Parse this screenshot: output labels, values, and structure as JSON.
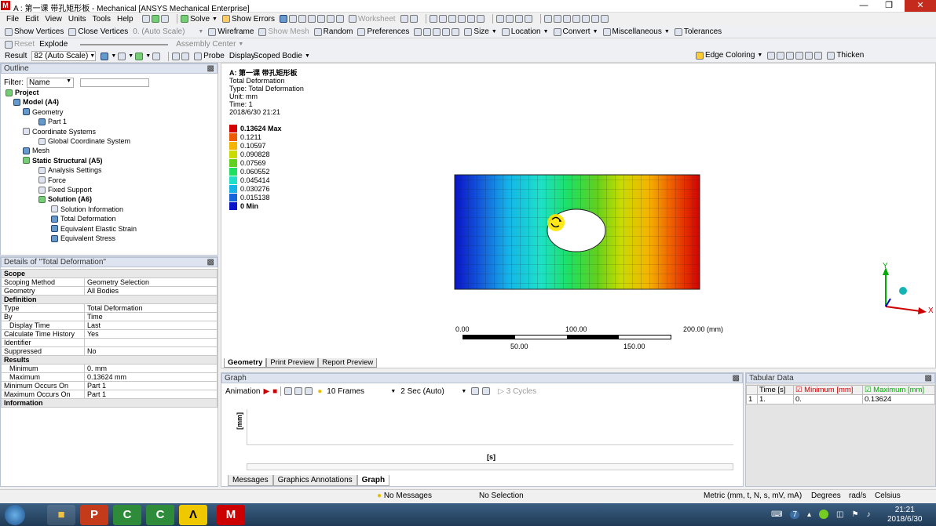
{
  "window": {
    "title": "A : 第一课 带孔矩形板 - Mechanical [ANSYS Mechanical Enterprise]",
    "app_icon_letter": "M"
  },
  "menu": [
    "File",
    "Edit",
    "View",
    "Units",
    "Tools",
    "Help"
  ],
  "toolbar1": {
    "solve": "Solve",
    "show_errors": "Show Errors",
    "worksheet": "Worksheet"
  },
  "toolbar2": {
    "show_vertices": "Show Vertices",
    "close_vertices": "Close Vertices",
    "auto_scale": "0. (Auto Scale)",
    "wireframe": "Wireframe",
    "show_mesh": "Show Mesh",
    "random": "Random",
    "preferences": "Preferences",
    "size": "Size",
    "location": "Location",
    "convert": "Convert",
    "miscellaneous": "Miscellaneous",
    "tolerances": "Tolerances"
  },
  "toolbar3": {
    "reset": "Reset",
    "explode": "Explode",
    "assembly_center": "Assembly Center"
  },
  "toolbar4": {
    "result_label": "Result",
    "scale_value": "82 (Auto Scale)",
    "probe": "Probe",
    "display_label": "Display",
    "display_value": "Scoped Bodie",
    "edge_coloring": "Edge Coloring",
    "thicken": "Thicken"
  },
  "outline": {
    "header": "Outline",
    "filter_label": "Filter:",
    "filter_value": "Name",
    "items": [
      {
        "label": "Project",
        "bold": true
      },
      {
        "label": "Model (A4)",
        "bold": true
      },
      {
        "label": "Geometry"
      },
      {
        "label": "Part 1"
      },
      {
        "label": "Coordinate Systems"
      },
      {
        "label": "Global Coordinate System"
      },
      {
        "label": "Mesh"
      },
      {
        "label": "Static Structural (A5)",
        "bold": true
      },
      {
        "label": "Analysis Settings"
      },
      {
        "label": "Force"
      },
      {
        "label": "Fixed Support"
      },
      {
        "label": "Solution (A6)",
        "bold": true
      },
      {
        "label": "Solution Information"
      },
      {
        "label": "Total Deformation"
      },
      {
        "label": "Equivalent Elastic Strain"
      },
      {
        "label": "Equivalent Stress"
      }
    ]
  },
  "details": {
    "header": "Details of \"Total Deformation\"",
    "rows": [
      {
        "section": "Scope"
      },
      {
        "k": "Scoping Method",
        "v": "Geometry Selection"
      },
      {
        "k": "Geometry",
        "v": "All Bodies"
      },
      {
        "section": "Definition"
      },
      {
        "k": "Type",
        "v": "Total Deformation"
      },
      {
        "k": "By",
        "v": "Time"
      },
      {
        "k": "Display Time",
        "v": "Last"
      },
      {
        "k": "Calculate Time History",
        "v": "Yes"
      },
      {
        "k": "Identifier",
        "v": ""
      },
      {
        "k": "Suppressed",
        "v": "No"
      },
      {
        "section": "Results"
      },
      {
        "k": "Minimum",
        "v": "0. mm"
      },
      {
        "k": "Maximum",
        "v": "0.13624 mm"
      },
      {
        "k": "Minimum Occurs On",
        "v": "Part 1"
      },
      {
        "k": "Maximum Occurs On",
        "v": "Part 1"
      },
      {
        "section": "Information"
      }
    ]
  },
  "viewport": {
    "heading": "A: 第一课 带孔矩形板",
    "info": [
      "Total Deformation",
      "Type: Total Deformation",
      "Unit: mm",
      "Time: 1",
      "2018/6/30 21:21"
    ],
    "legend": [
      {
        "label": "0.13624 Max",
        "color": "#d40000"
      },
      {
        "label": "0.1211",
        "color": "#ee5a00"
      },
      {
        "label": "0.10597",
        "color": "#f5b400"
      },
      {
        "label": "0.090828",
        "color": "#c8dc00"
      },
      {
        "label": "0.07569",
        "color": "#62d01e"
      },
      {
        "label": "0.060552",
        "color": "#1ee060"
      },
      {
        "label": "0.045414",
        "color": "#1ee0c8"
      },
      {
        "label": "0.030276",
        "color": "#14b4e8"
      },
      {
        "label": "0.015138",
        "color": "#1464dc"
      },
      {
        "label": "0 Min",
        "color": "#0a14c8"
      }
    ],
    "scale": {
      "t0": "0.00",
      "t100": "100.00",
      "t200": "200.00 (mm)",
      "t50": "50.00",
      "t150": "150.00"
    },
    "axes": {
      "x": "X",
      "y": "Y"
    },
    "tabs": [
      "Geometry",
      "Print Preview",
      "Report Preview"
    ]
  },
  "graph": {
    "header": "Graph",
    "animation": "Animation",
    "frames": "10 Frames",
    "duration": "2 Sec (Auto)",
    "cycles": "3 Cycles",
    "ylabel": "[mm]",
    "xlabel": "[s]"
  },
  "tabular": {
    "header": "Tabular Data",
    "columns": [
      "Time [s]",
      "Minimum [mm]",
      "Maximum [mm]"
    ],
    "rows": [
      {
        "idx": "1",
        "time": "1.",
        "min": "0.",
        "max": "0.13624"
      }
    ]
  },
  "bottom_tabs": [
    "Messages",
    "Graphics Annotations",
    "Graph"
  ],
  "status": {
    "messages": "No Messages",
    "selection": "No Selection",
    "units": "Metric (mm, t, N, s, mV, mA)",
    "angle": "Degrees",
    "rot": "rad/s",
    "temp": "Celsius"
  },
  "taskbar": {
    "time": "21:21",
    "date": "2018/6/30",
    "badge": "7"
  }
}
